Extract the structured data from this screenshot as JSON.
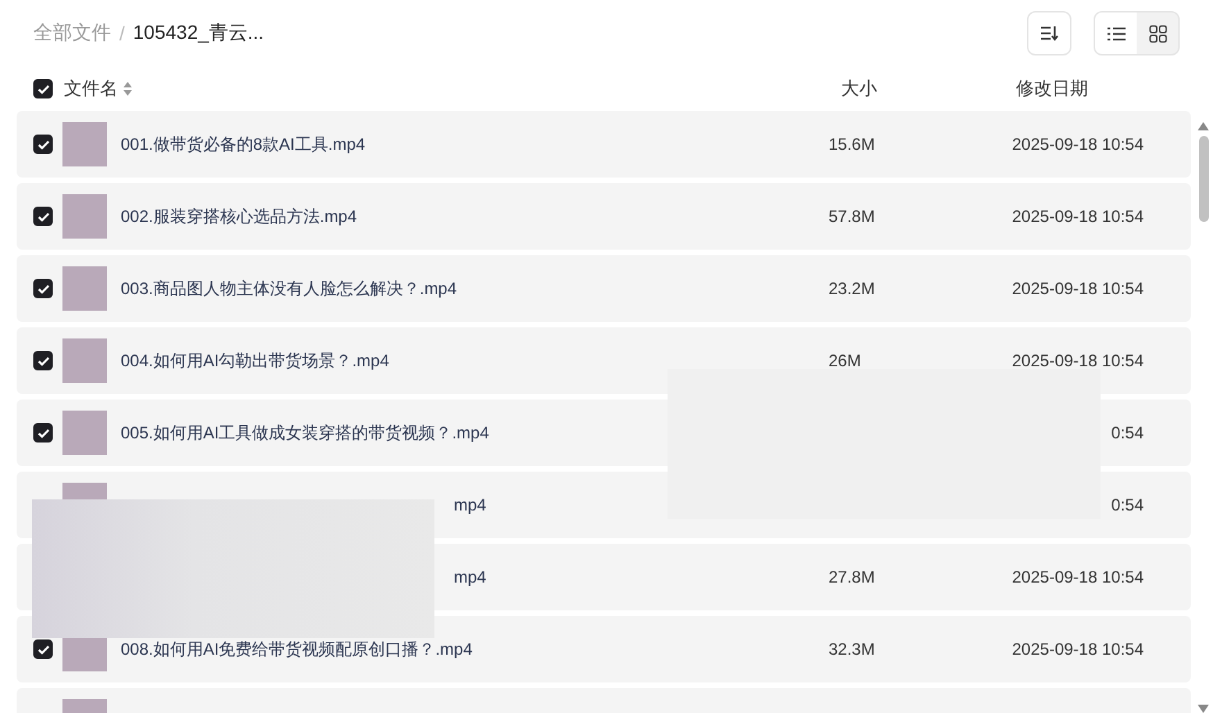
{
  "breadcrumb": {
    "root": "全部文件",
    "separator": "/",
    "current": "105432_青云..."
  },
  "view_toggle": [
    {
      "kind": "list",
      "selected": true
    },
    {
      "kind": "grid",
      "selected": false
    }
  ],
  "header": {
    "checked": true,
    "columns": [
      "文件名",
      "大小",
      "修改日期"
    ]
  },
  "rows": [
    {
      "kind": "full",
      "checked": true,
      "name": "001.做带货必备的8款AI工具.mp4",
      "size": "15.6M",
      "date": "2025-09-18 10:54"
    },
    {
      "kind": "full",
      "checked": true,
      "name": "002.服装穿搭核心选品方法.mp4",
      "size": "57.8M",
      "date": "2025-09-18 10:54"
    },
    {
      "kind": "full",
      "checked": true,
      "name": "003.商品图人物主体没有人脸怎么解决？.mp4",
      "size": "23.2M",
      "date": "2025-09-18 10:54"
    },
    {
      "kind": "full",
      "checked": true,
      "name": "004.如何用AI勾勒出带货场景？.mp4",
      "size": "26M",
      "date": "2025-09-18 10:54"
    },
    {
      "kind": "full",
      "checked": true,
      "name": "005.如何用AI工具做成女装穿搭的带货视频？.mp4",
      "date": "0:54"
    },
    {
      "kind": "covered",
      "name": "mp4",
      "date": "0:54"
    },
    {
      "kind": "covered",
      "name": "mp4",
      "size": "27.8M",
      "date": "2025-09-18 10:54"
    },
    {
      "kind": "full",
      "checked": true,
      "name": "008.如何用AI免费给带货视频配原创口播？.mp4",
      "size": "32.3M",
      "date": "2025-09-18 10:54"
    },
    {
      "kind": "cut"
    }
  ]
}
